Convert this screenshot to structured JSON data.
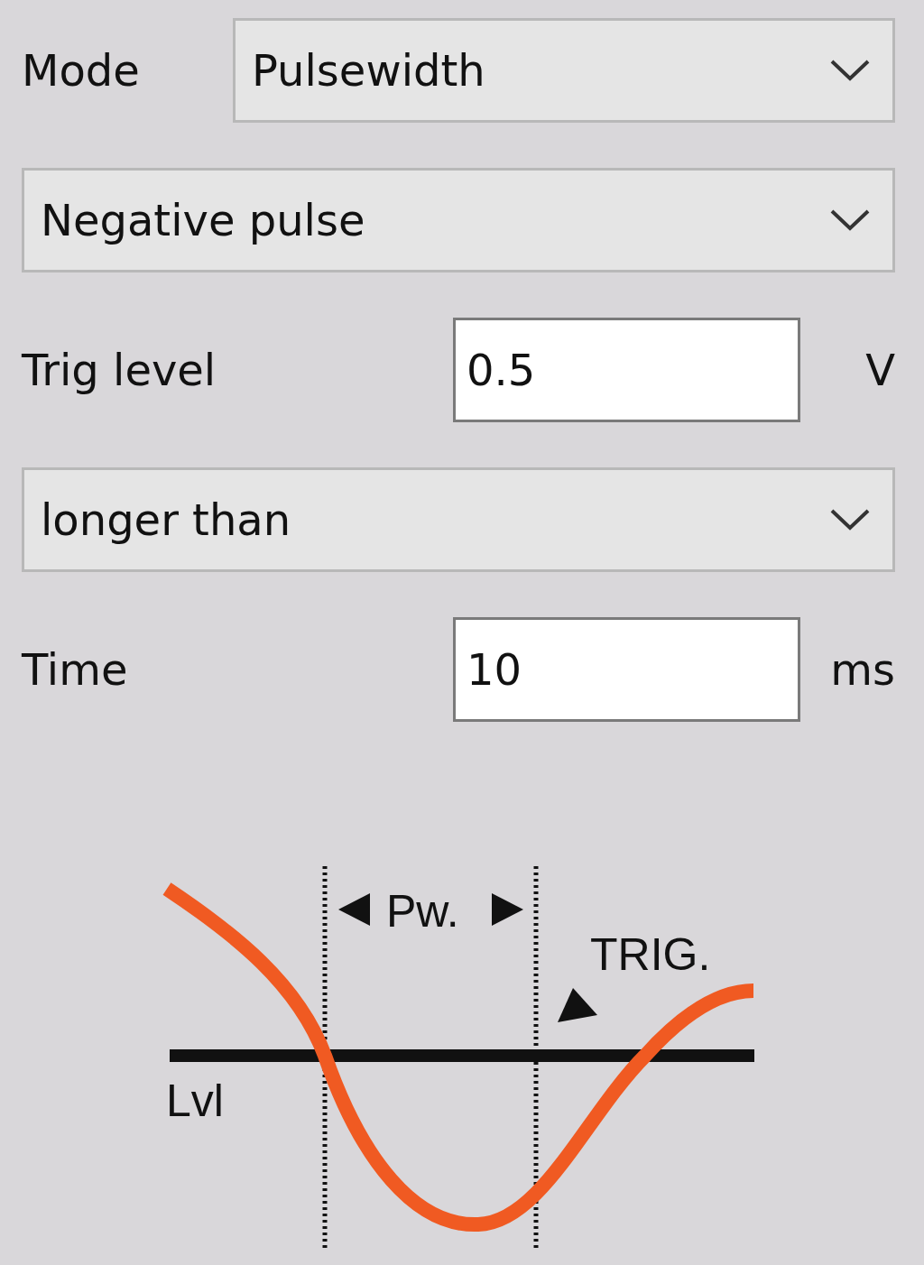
{
  "fields": [
    {
      "kind": "select",
      "label": "Mode",
      "value": "Pulsewidth"
    },
    {
      "kind": "select",
      "value": "Negative pulse"
    },
    {
      "kind": "input",
      "label": "Trig level",
      "value": "0.5",
      "unit": "V"
    },
    {
      "kind": "select",
      "value": "longer than"
    },
    {
      "kind": "input",
      "label": "Time",
      "value": "10",
      "unit": "ms"
    }
  ],
  "diagram": {
    "pulse_label": "Pw.",
    "trigger_label": "TRIG.",
    "level_label": "Lvl"
  }
}
